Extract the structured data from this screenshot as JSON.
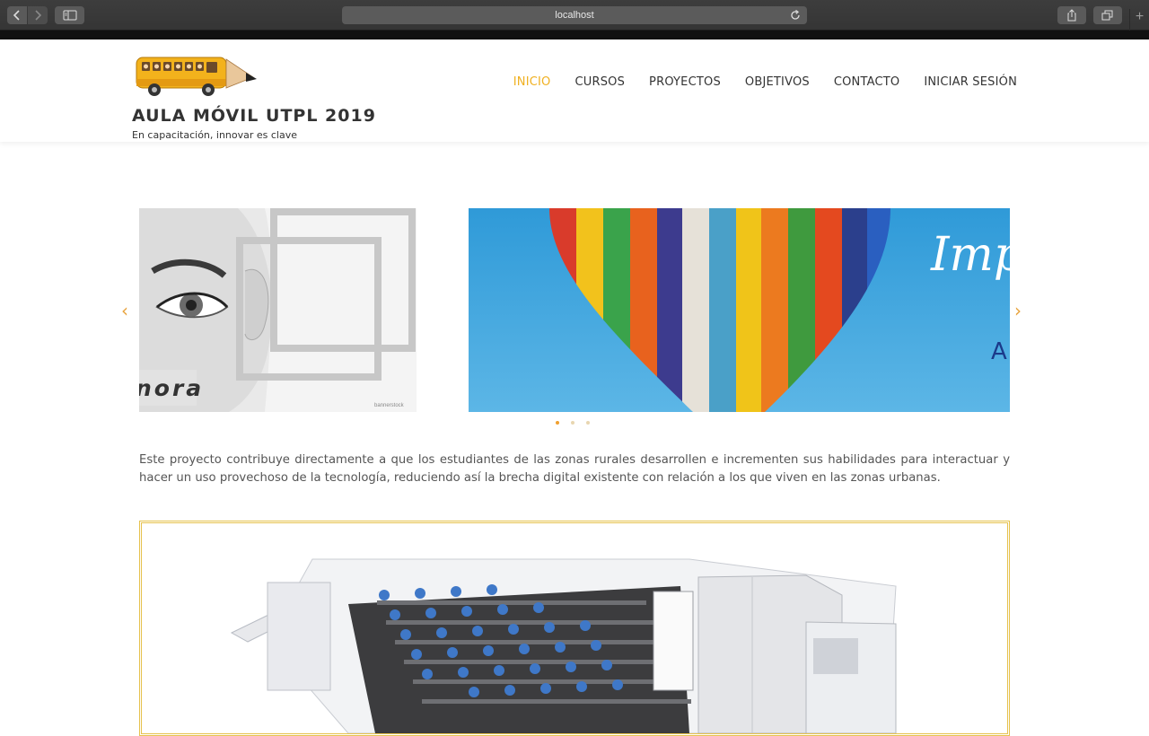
{
  "browser": {
    "url": "localhost",
    "icons": [
      "back-icon",
      "forward-icon",
      "sidebar-icon",
      "reload-icon",
      "share-icon",
      "tabs-icon",
      "new-tab-icon"
    ]
  },
  "site": {
    "title": "AULA MÓVIL UTPL 2019",
    "tagline": "En capacitación, innovar es clave",
    "accent_color": "#f0b020"
  },
  "menu": {
    "items": [
      {
        "label": "INICIO",
        "active": true
      },
      {
        "label": "CURSOS"
      },
      {
        "label": "PROYECTOS"
      },
      {
        "label": "OBJETIVOS"
      },
      {
        "label": "CONTACTO"
      },
      {
        "label": "INICIAR SESIÓN"
      }
    ]
  },
  "slider": {
    "left_slide_text": "nora",
    "left_slide_credit": "bannerstock",
    "right_slide_text": "Imp",
    "right_slide_subtext": "A",
    "prev_label": "‹",
    "next_label": "›",
    "slide_count": 3,
    "active_index": 0
  },
  "intro": {
    "text": "Este proyecto contribuye directamente a que los estudiantes de las zonas rurales desarrollen e incrementen sus habilidades para interactuar y hacer un uso provechoso de la tecnología, reduciendo así la brecha digital existente con relación a los que viven en las zonas urbanas."
  }
}
